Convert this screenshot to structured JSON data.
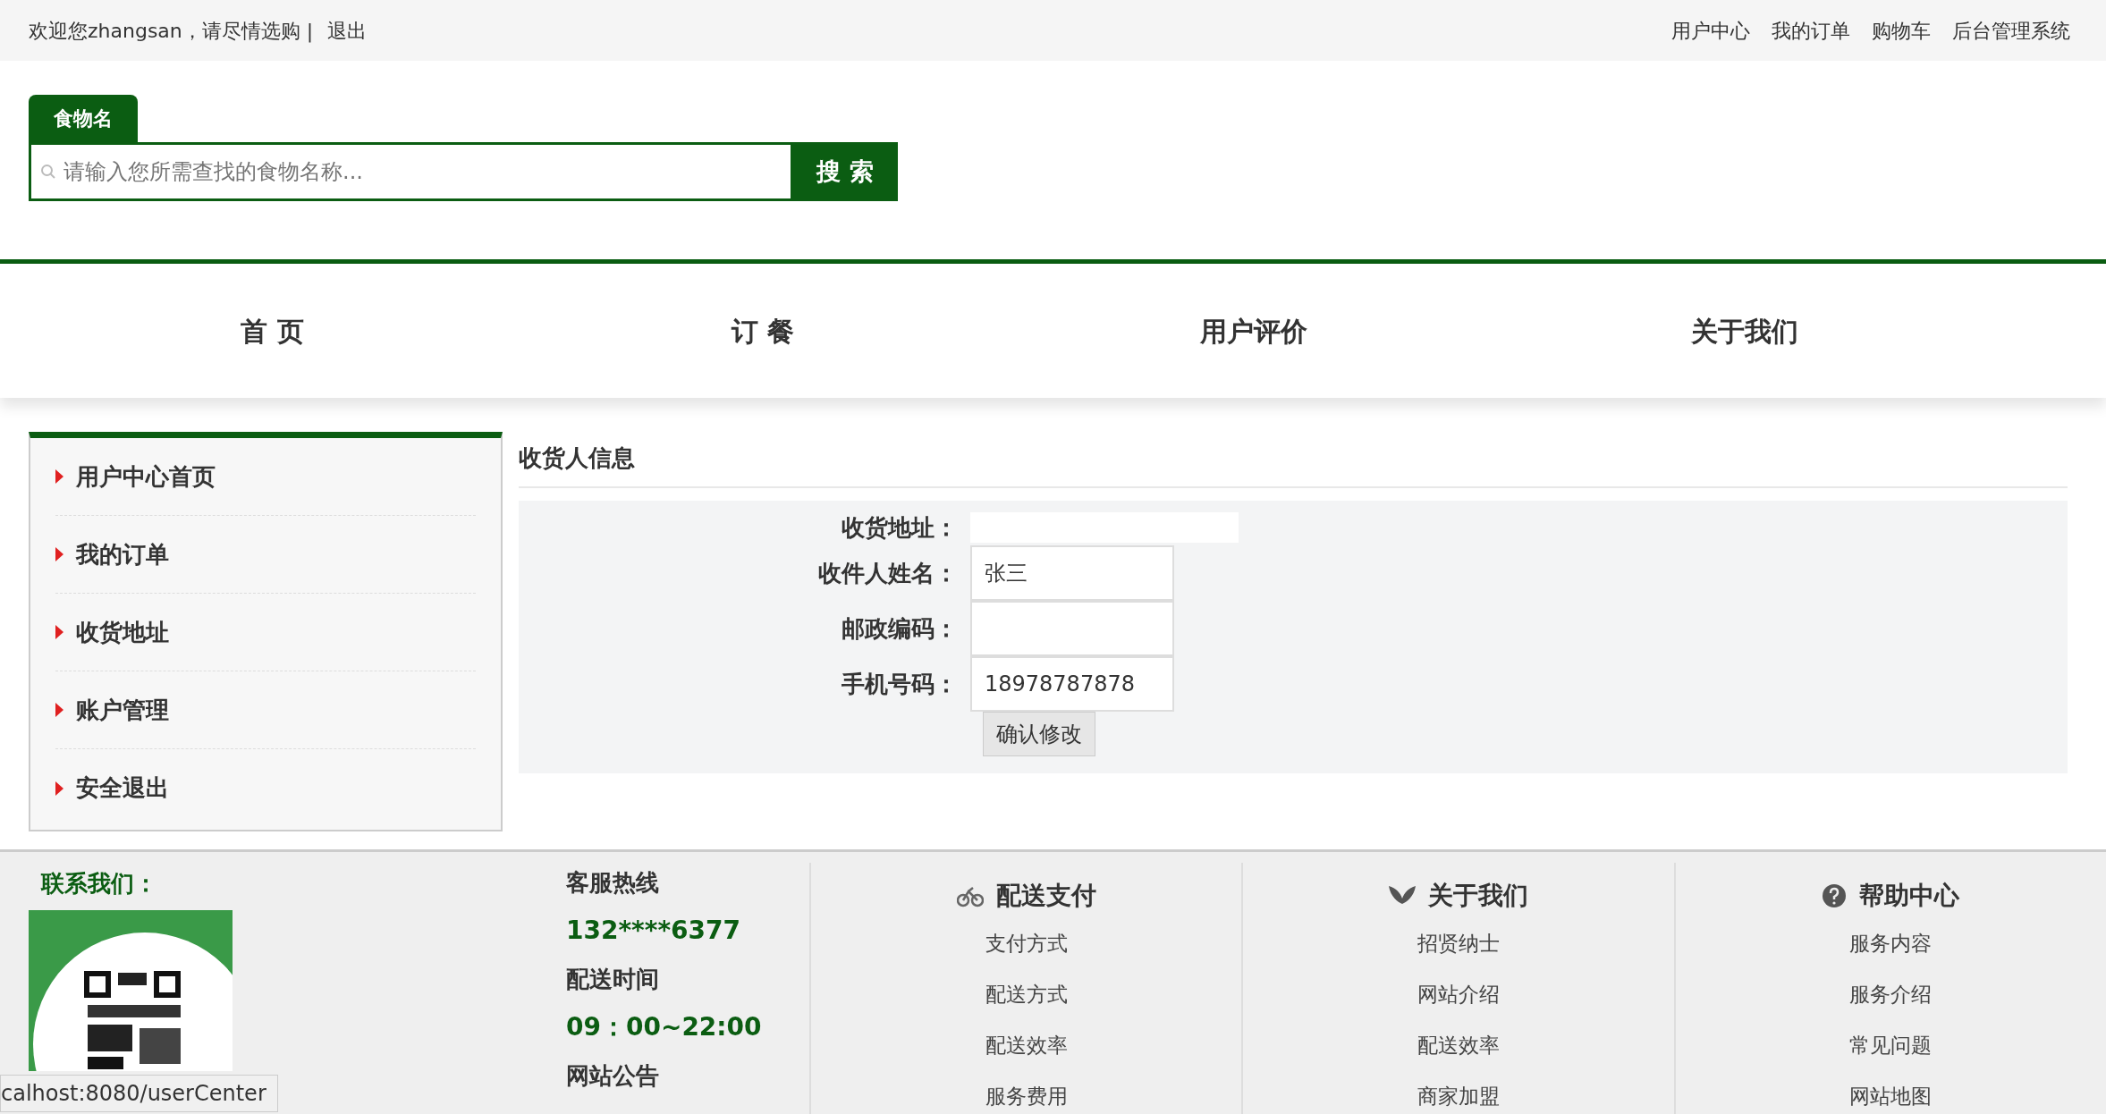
{
  "top_bar": {
    "welcome": "欢迎您zhangsan，请尽情选购 |",
    "logout": "退出",
    "links": [
      "用户中心",
      "我的订单",
      "购物车",
      "后台管理系统"
    ]
  },
  "search": {
    "tab": "食物名",
    "placeholder": "请输入您所需查找的食物名称...",
    "button": "搜 索"
  },
  "nav": [
    "首 页",
    "订 餐",
    "用户评价",
    "关于我们"
  ],
  "sidebar": {
    "items": [
      "用户中心首页",
      "我的订单",
      "收货地址",
      "账户管理",
      "安全退出"
    ]
  },
  "form": {
    "title": "收货人信息",
    "fields": [
      {
        "kind": "plain",
        "label": "收货地址："
      },
      {
        "kind": "boxed",
        "label": "收件人姓名：",
        "value": "张三"
      },
      {
        "kind": "boxed",
        "label": "邮政编码："
      },
      {
        "kind": "boxed",
        "label": "手机号码：",
        "value": "18978787878"
      }
    ],
    "submit": "确认修改"
  },
  "footer": {
    "contact_title": "联系我们：",
    "info": [
      {
        "kind": "heading",
        "text": "客服热线"
      },
      {
        "kind": "value",
        "text": "132****6377"
      },
      {
        "kind": "heading",
        "text": "配送时间"
      },
      {
        "kind": "value",
        "text": "09：00~22:00"
      },
      {
        "kind": "heading",
        "text": "网站公告"
      }
    ],
    "columns": [
      {
        "title": "配送支付",
        "links": [
          "支付方式",
          "配送方式",
          "配送效率",
          "服务费用"
        ]
      },
      {
        "title": "关于我们",
        "links": [
          "招贤纳士",
          "网站介绍",
          "配送效率",
          "商家加盟"
        ]
      },
      {
        "title": "帮助中心",
        "links": [
          "服务内容",
          "服务介绍",
          "常见问题",
          "网站地图"
        ]
      }
    ]
  },
  "status_url": "calhost:8080/userCenter"
}
